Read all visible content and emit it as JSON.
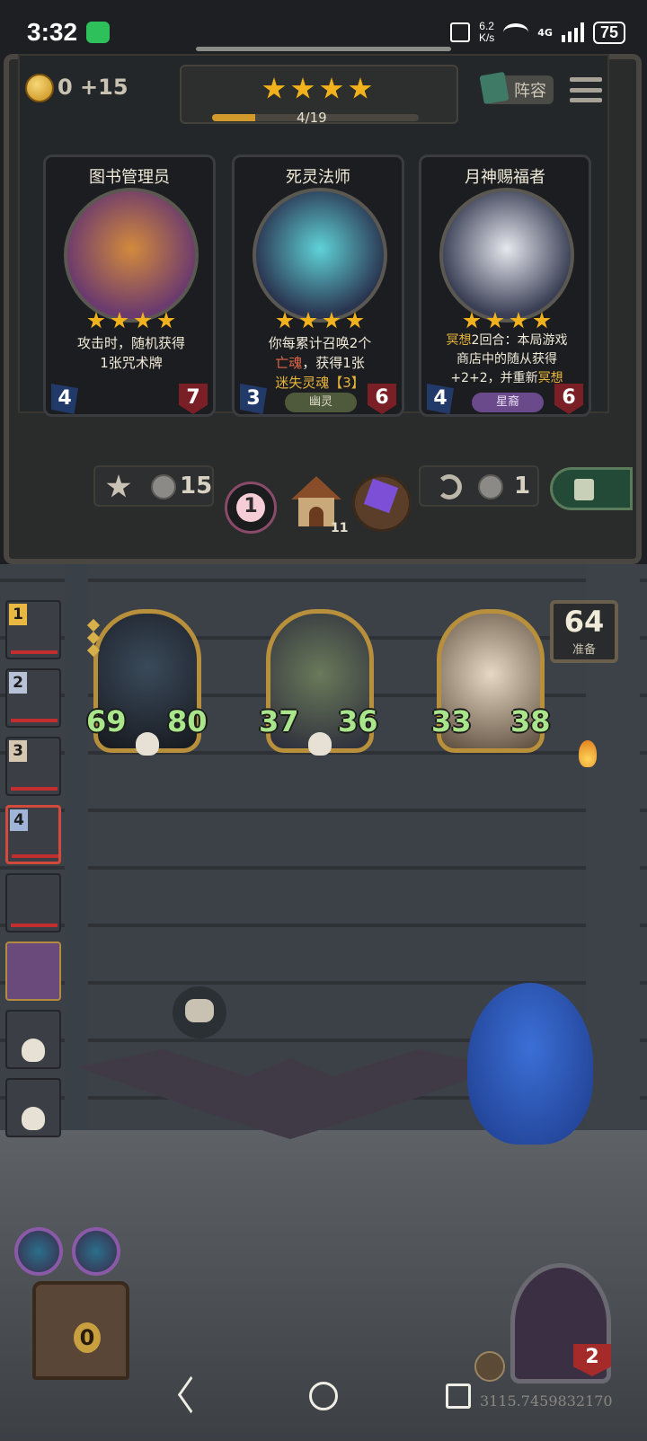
{
  "status_bar": {
    "time": "3:32",
    "net_speed_value": "6.2",
    "net_speed_unit": "K/s",
    "network": "4G",
    "battery": "75"
  },
  "shop": {
    "gold_text": "0 +15",
    "tier_stars": 4,
    "xp_text": "4/19",
    "xp_progress": 0.21,
    "lineup_label": "阵容",
    "cards": [
      {
        "name": "图书管理员",
        "desc_parts": [
          "攻击时，随机获得",
          "1张咒术牌"
        ],
        "attack": "4",
        "health": "7",
        "tribe": ""
      },
      {
        "name": "死灵法师",
        "desc_line1": "你每累计召唤2个",
        "desc_hl1": "亡魂",
        "desc_line2": "，获得1张",
        "desc_hl2": "迷失灵魂【3】",
        "attack": "3",
        "health": "6",
        "tribe": "幽灵"
      },
      {
        "name": "月神赐福者",
        "desc_hl1": "冥想",
        "desc_line1": "2回合：本局游戏",
        "desc_line2": "商店中的随从获得",
        "desc_line3": "+2+2，并重新",
        "desc_hl2": "冥想",
        "attack": "4",
        "health": "6",
        "tribe": "星裔"
      }
    ],
    "upgrade_cost": "15",
    "flower_count": "1",
    "house_count": "11",
    "refresh_cost": "1"
  },
  "board": {
    "timer_value": "64",
    "timer_label": "准备",
    "minions": [
      {
        "attack": "69",
        "health": "80"
      },
      {
        "attack": "37",
        "health": "36"
      },
      {
        "attack": "33",
        "health": "38"
      }
    ],
    "opponent_ranks": [
      "1",
      "2",
      "3",
      "4"
    ],
    "hand_count": "0",
    "hero_health": "2",
    "coords": "3115.7459832170"
  },
  "colors": {
    "gold": "#f2b21b",
    "attack_green": "#a9e58a",
    "highlight": "#e7b43a"
  }
}
